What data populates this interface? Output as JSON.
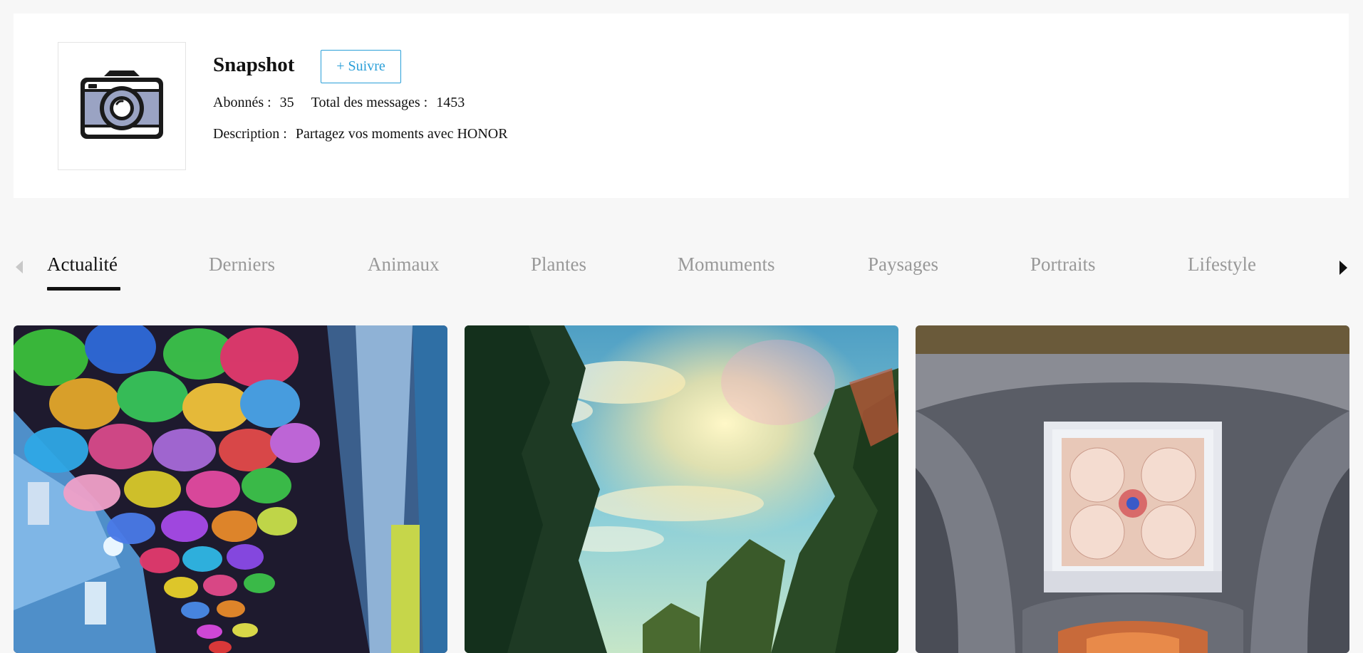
{
  "profile": {
    "name": "Snapshot",
    "follow_label": "+ Suivre",
    "followers_label": "Abonnés :",
    "followers_value": "35",
    "total_label": "Total des messages :",
    "total_value": "1453",
    "description_label": "Description :",
    "description_value": "Partagez vos moments avec HONOR",
    "avatar_icon": "camera-icon"
  },
  "tabs": [
    {
      "label": "Actualité",
      "active": true
    },
    {
      "label": "Derniers"
    },
    {
      "label": "Animaux"
    },
    {
      "label": "Plantes"
    },
    {
      "label": "Momuments"
    },
    {
      "label": "Paysages"
    },
    {
      "label": "Portraits"
    },
    {
      "label": "Lifestyle"
    }
  ],
  "nav": {
    "prev_icon": "chevron-left-icon",
    "next_icon": "chevron-right-icon"
  },
  "photos": [
    {
      "subject": "umbrellas"
    },
    {
      "subject": "sky-trees"
    },
    {
      "subject": "cathedral-ceiling"
    }
  ],
  "colors": {
    "accent": "#2a9fd8",
    "page_bg": "#f7f7f7",
    "active_tab": "#111111",
    "inactive_tab": "#999999"
  }
}
